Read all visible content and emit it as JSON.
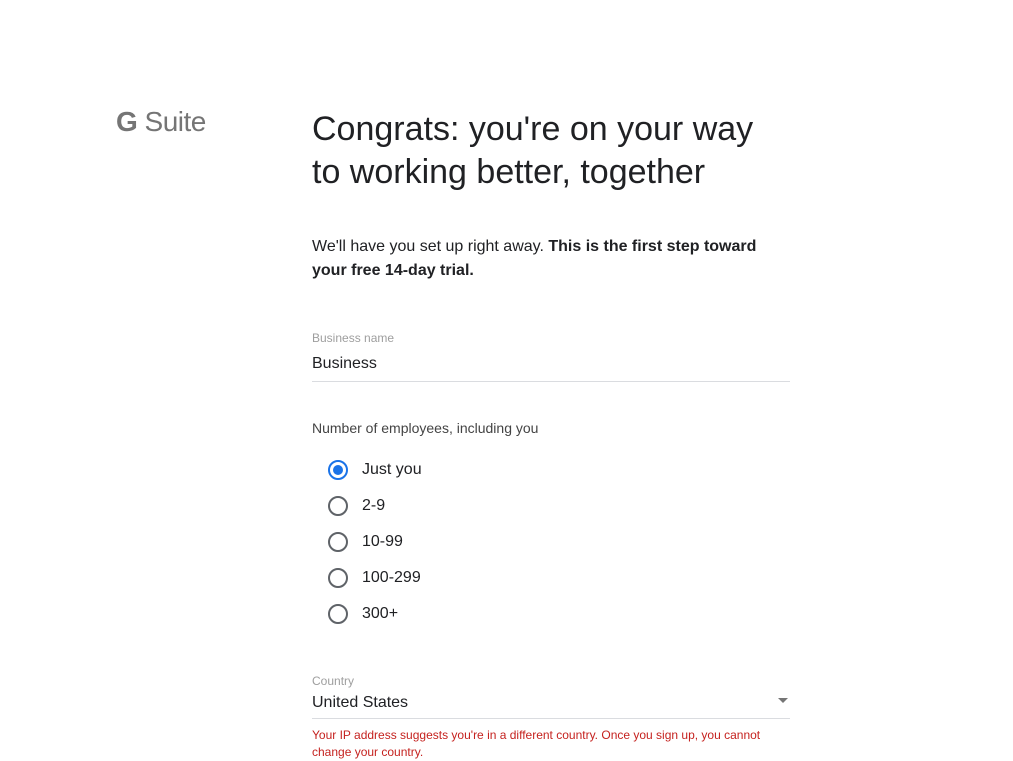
{
  "logo": {
    "g": "G",
    "suite": " Suite"
  },
  "heading": "Congrats: you're on your way to working better, together",
  "intro": {
    "plain": "We'll have you set up right away. ",
    "bold": "This is the first step toward your free 14-day trial."
  },
  "business_name": {
    "label": "Business name",
    "value": "Business"
  },
  "employees": {
    "label": "Number of employees, including you",
    "options": [
      {
        "label": "Just you",
        "selected": true
      },
      {
        "label": "2-9",
        "selected": false
      },
      {
        "label": "10-99",
        "selected": false
      },
      {
        "label": "100-299",
        "selected": false
      },
      {
        "label": "300+",
        "selected": false
      }
    ]
  },
  "country": {
    "label": "Country",
    "value": "United States",
    "warning": "Your IP address suggests you're in a different country. Once you sign up, you cannot change your country."
  }
}
